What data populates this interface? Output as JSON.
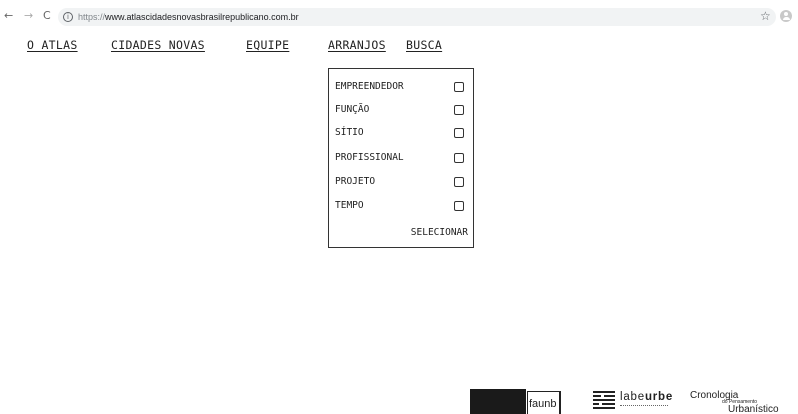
{
  "browser": {
    "back_glyph": "←",
    "forward_glyph": "→",
    "reload_glyph": "C",
    "info_glyph": "i",
    "url_protocol": "https://",
    "url_host": "www.atlascidadesnovasbrasilrepublicano.com.br",
    "star_glyph": "☆",
    "icons": [
      "back-arrow-icon",
      "forward-arrow-icon",
      "reload-icon",
      "info-icon",
      "star-icon",
      "profile-icon"
    ]
  },
  "nav": {
    "atlas": "O ATLAS",
    "cidades": "CIDADES NOVAS",
    "equipe": "EQUIPE",
    "arranjos": "ARRANJOS",
    "busca": "BUSCA"
  },
  "dropdown": {
    "options": [
      {
        "label": "EMPREENDEDOR",
        "checked": false
      },
      {
        "label": "FUNÇÃO",
        "checked": false
      },
      {
        "label": "SÍTIO",
        "checked": false
      },
      {
        "label": "PROFISSIONAL",
        "checked": false
      },
      {
        "label": "PROJETO",
        "checked": false
      },
      {
        "label": "TEMPO",
        "checked": false
      }
    ],
    "submit_label": "SELECIONAR"
  },
  "footer": {
    "faunb": "faunb",
    "labeurbe_light": "labe",
    "labeurbe_bold": "urbe",
    "cronologia_line1": "Cronologia",
    "cronologia_line2": "do Pensamento",
    "cronologia_line3": "Urbanístico"
  },
  "colors": {
    "text": "#222222",
    "omnibox": "#f1f3f4",
    "background": "#ffffff"
  }
}
